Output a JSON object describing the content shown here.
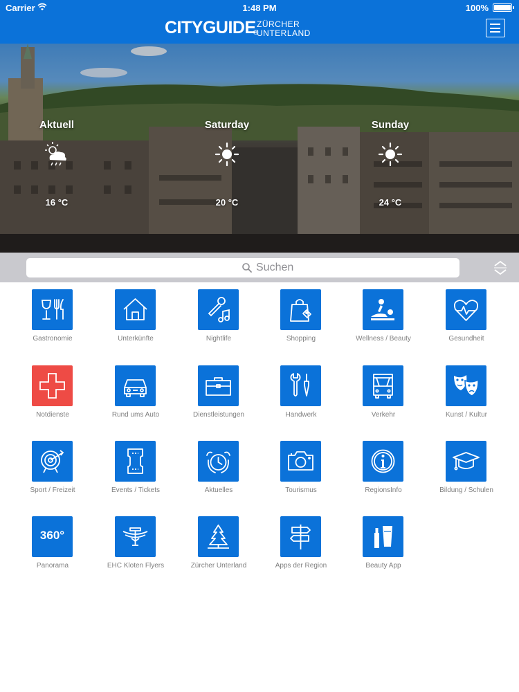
{
  "status": {
    "carrier": "Carrier",
    "time": "1:48 PM",
    "battery": "100%"
  },
  "header": {
    "brand": "CITYGUIDE",
    "reg_mark": "®",
    "region_line1": "ZÜRCHER",
    "region_line2": "UNTERLAND",
    "menu_icon": "hamburger-menu-icon",
    "color": "#0b72d9"
  },
  "weather": [
    {
      "day": "Aktuell",
      "temp": "16 °C",
      "icon": "cloud-rain-sun-icon"
    },
    {
      "day": "Saturday",
      "temp": "20 °C",
      "icon": "sun-icon"
    },
    {
      "day": "Sunday",
      "temp": "24 °C",
      "icon": "sun-icon"
    }
  ],
  "search": {
    "placeholder": "Suchen",
    "sort_icon": "sort-icon"
  },
  "categories": [
    {
      "label": "Gastronomie",
      "icon": "cutlery-icon"
    },
    {
      "label": "Unterkünfte",
      "icon": "house-icon"
    },
    {
      "label": "Nightlife",
      "icon": "microphone-music-icon"
    },
    {
      "label": "Shopping",
      "icon": "shopping-bag-icon"
    },
    {
      "label": "Wellness / Beauty",
      "icon": "massage-icon"
    },
    {
      "label": "Gesundheit",
      "icon": "heart-pulse-icon"
    },
    {
      "label": "Notdienste",
      "icon": "cross-icon",
      "accent": "#ee4b45"
    },
    {
      "label": "Rund ums Auto",
      "icon": "car-icon"
    },
    {
      "label": "Dienstleistungen",
      "icon": "briefcase-icon"
    },
    {
      "label": "Handwerk",
      "icon": "tools-icon"
    },
    {
      "label": "Verkehr",
      "icon": "bus-icon"
    },
    {
      "label": "Kunst / Kultur",
      "icon": "theater-masks-icon"
    },
    {
      "label": "Sport / Freizeit",
      "icon": "target-icon"
    },
    {
      "label": "Events / Tickets",
      "icon": "ticket-icon"
    },
    {
      "label": "Aktuelles",
      "icon": "alarm-clock-icon"
    },
    {
      "label": "Tourismus",
      "icon": "camera-icon"
    },
    {
      "label": "RegionsInfo",
      "icon": "info-icon"
    },
    {
      "label": "Bildung / Schulen",
      "icon": "graduation-cap-icon"
    },
    {
      "label": "Panorama",
      "icon": "panorama-360-icon",
      "text": "360°"
    },
    {
      "label": "EHC Kloten Flyers",
      "icon": "flyers-logo-icon"
    },
    {
      "label": "Zürcher Unterland",
      "icon": "tree-icon"
    },
    {
      "label": "Apps der Region",
      "icon": "signpost-icon"
    },
    {
      "label": "Beauty App",
      "icon": "cosmetics-icon"
    }
  ]
}
